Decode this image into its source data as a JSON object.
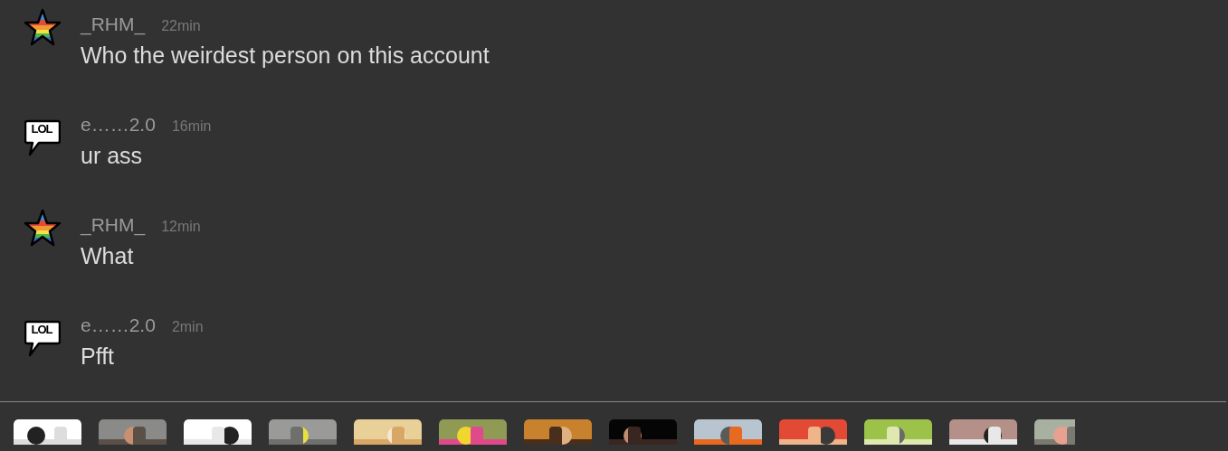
{
  "comments": [
    {
      "avatar": {
        "kind": "rainbow-star"
      },
      "username": "_RHM_",
      "time": "22min",
      "text": "Who the weirdest person on this account"
    },
    {
      "avatar": {
        "kind": "speech-bubble",
        "text": "LOL"
      },
      "username": "e……2.0",
      "time": "16min",
      "text": "ur ass"
    },
    {
      "avatar": {
        "kind": "rainbow-star"
      },
      "username": "_RHM_",
      "time": "12min",
      "text": "What"
    },
    {
      "avatar": {
        "kind": "speech-bubble",
        "text": "LOL"
      },
      "username": "e……2.0",
      "time": "2min",
      "text": "Pfft"
    }
  ]
}
